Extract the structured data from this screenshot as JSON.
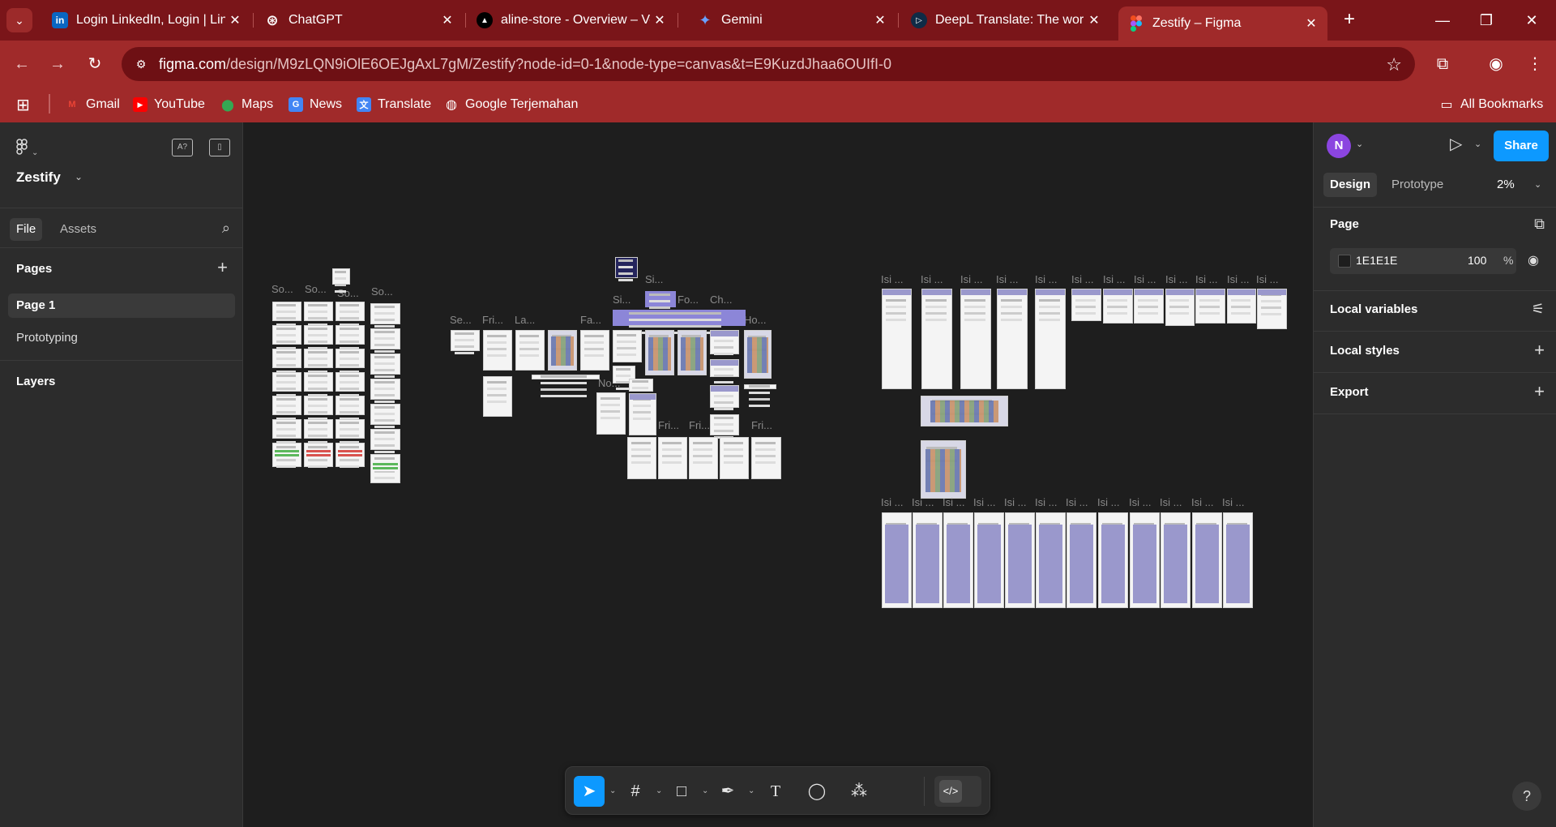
{
  "browser": {
    "tabs": [
      {
        "title": "Login LinkedIn, Login | Link",
        "icon": "linkedin-icon",
        "color": "#0a66c2",
        "glyph": "in"
      },
      {
        "title": "ChatGPT",
        "icon": "chatgpt-icon",
        "color": "#ffffff",
        "glyph": "⊛"
      },
      {
        "title": "aline-store - Overview – Ve",
        "icon": "vercel-icon",
        "color": "#000000",
        "glyph": "▲"
      },
      {
        "title": "Gemini",
        "icon": "gemini-icon",
        "color": "#4b8bf5",
        "glyph": "✦"
      },
      {
        "title": "DeepL Translate: The world",
        "icon": "deepl-icon",
        "color": "#0f2b46",
        "glyph": "▷"
      },
      {
        "title": "Zestify – Figma",
        "icon": "figma-icon",
        "color": "#f24e1e",
        "glyph": "F"
      }
    ],
    "active_tab": 5,
    "url_host": "figma.com",
    "url_path": "/design/M9zLQN9iOlE6OEJgAxL7gM/Zestify?node-id=0-1&node-type=canvas&t=E9KuzdJhaa6OUIfI-0",
    "bookmarks": [
      {
        "label": "Gmail",
        "icon": "gmail-icon",
        "color": "#ea4335",
        "glyph": "M"
      },
      {
        "label": "YouTube",
        "icon": "youtube-icon",
        "color": "#ff0000",
        "glyph": "▶"
      },
      {
        "label": "Maps",
        "icon": "maps-icon",
        "color": "#34a853",
        "glyph": "⬤"
      },
      {
        "label": "News",
        "icon": "news-icon",
        "color": "#4285f4",
        "glyph": "G"
      },
      {
        "label": "Translate",
        "icon": "translate-icon",
        "color": "#4285f4",
        "glyph": "文"
      },
      {
        "label": "Google Terjemahan",
        "icon": "globe-icon",
        "color": "#ffffff",
        "glyph": "◍"
      }
    ],
    "all_bookmarks": "All Bookmarks"
  },
  "figma": {
    "project_name": "Zestify",
    "left_tabs": [
      "File",
      "Assets"
    ],
    "pages_heading": "Pages",
    "pages": [
      "Page 1",
      "Prototyping"
    ],
    "layers_heading": "Layers",
    "avatar_initial": "N",
    "share_label": "Share",
    "right_tabs": [
      "Design",
      "Prototype"
    ],
    "zoom": "2%",
    "page_heading": "Page",
    "background_hex": "1E1E1E",
    "background_opacity": "100",
    "opacity_unit": "%",
    "local_variables": "Local variables",
    "local_styles": "Local styles",
    "export": "Export",
    "help": "?"
  },
  "canvas_labels": {
    "so": "So...",
    "se": "Se...",
    "fri": "Fri...",
    "la": "La...",
    "fa": "Fa...",
    "si": "Si...",
    "fo": "Fo...",
    "ch": "Ch...",
    "ho": "Ho...",
    "no": "No...",
    "isi": "Isi ..."
  },
  "colors": {
    "browser_frame": "#8b1a1a",
    "figma_bg": "#1e1e1e",
    "panel": "#2c2c2c",
    "accent": "#0d99ff",
    "lavender": "#9a98cc"
  }
}
